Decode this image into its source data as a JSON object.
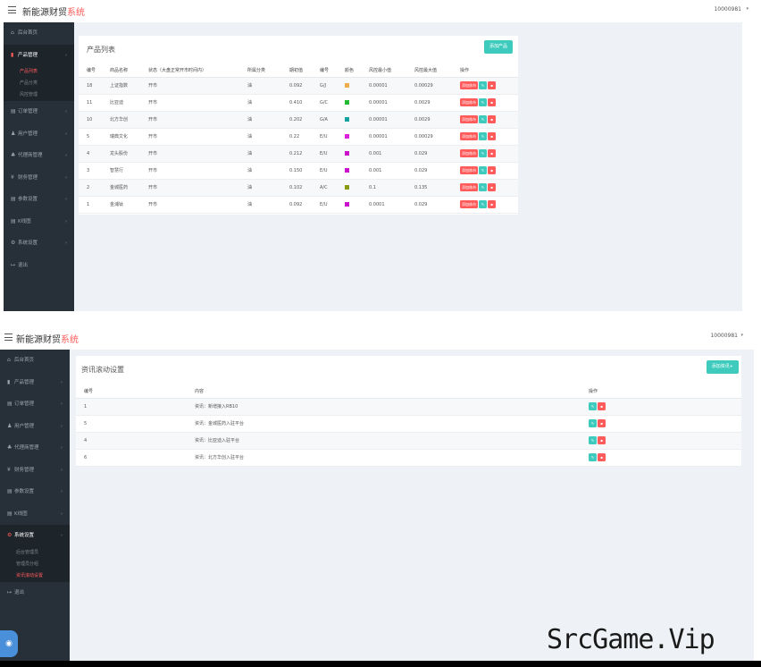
{
  "app": {
    "brand_main": "新能源财贸",
    "brand_accent": "系统",
    "user": "10000981"
  },
  "shot1": {
    "nav": [
      {
        "icon": "home-icon",
        "glyph": "⌂",
        "label": "后台首页"
      },
      {
        "icon": "product-icon",
        "glyph": "▮",
        "label": "产品管理",
        "active": true,
        "sub": [
          {
            "label": "产品列表",
            "current": true
          },
          {
            "label": "产品分类"
          },
          {
            "label": "风控管理"
          }
        ]
      },
      {
        "icon": "order-icon",
        "glyph": "▤",
        "label": "订单管理"
      },
      {
        "icon": "user-icon",
        "glyph": "♟",
        "label": "用户管理"
      },
      {
        "icon": "agent-icon",
        "glyph": "♣",
        "label": "代理商管理"
      },
      {
        "icon": "finance-icon",
        "glyph": "¥",
        "label": "财务管理"
      },
      {
        "icon": "params-icon",
        "glyph": "▤",
        "label": "参数设置"
      },
      {
        "icon": "log-icon",
        "glyph": "▤",
        "label": "K线图"
      },
      {
        "icon": "settings-icon",
        "glyph": "⚙",
        "label": "系统设置"
      },
      {
        "icon": "logout-icon",
        "glyph": "↦",
        "label": "退出"
      }
    ],
    "card_title": "产品列表",
    "add_button": "添加产品",
    "columns": [
      "编号",
      "商品名称",
      "状态（大盘正常开市时间内）",
      "所属分类",
      "期初值",
      "编号",
      "颜色",
      "风控最小值",
      "风控最大值",
      "操作"
    ],
    "rows": [
      {
        "id": "18",
        "name": "上证指数",
        "status": "开市",
        "cat": "油",
        "init": "0.092",
        "code": "G/J",
        "color": "#f0ad4e",
        "min": "0.00001",
        "max": "0.00029"
      },
      {
        "id": "11",
        "name": "比亚迪",
        "status": "开市",
        "cat": "油",
        "init": "0.410",
        "code": "G/C",
        "color": "#22bb33",
        "min": "0.00001",
        "max": "0.0029"
      },
      {
        "id": "10",
        "name": "北方华创",
        "status": "开市",
        "cat": "油",
        "init": "0.202",
        "code": "G/A",
        "color": "#17a2a2",
        "min": "0.00001",
        "max": "0.0029"
      },
      {
        "id": "5",
        "name": "瑞典文化",
        "status": "开市",
        "cat": "油",
        "init": "0.22",
        "code": "E/U",
        "color": "#dd22dd",
        "min": "0.00001",
        "max": "0.00029"
      },
      {
        "id": "4",
        "name": "龙头股份",
        "status": "开市",
        "cat": "油",
        "init": "0.212",
        "code": "E/U",
        "color": "#cc11cc",
        "min": "0.001",
        "max": "0.029"
      },
      {
        "id": "3",
        "name": "智慧行",
        "status": "开市",
        "cat": "油",
        "init": "0.150",
        "code": "E/U",
        "color": "#cc11cc",
        "min": "0.001",
        "max": "0.029"
      },
      {
        "id": "2",
        "name": "金城医药",
        "status": "开市",
        "cat": "油",
        "init": "0.102",
        "code": "A/C",
        "color": "#8a9a10",
        "min": "0.1",
        "max": "0.135"
      },
      {
        "id": "1",
        "name": "金浦钛",
        "status": "开市",
        "cat": "油",
        "init": "0.092",
        "code": "E/U",
        "color": "#cc11cc",
        "min": "0.0001",
        "max": "0.029"
      }
    ],
    "row_action_label": "添加休市"
  },
  "shot2": {
    "nav": [
      {
        "icon": "home-icon",
        "glyph": "⌂",
        "label": "后台首页"
      },
      {
        "icon": "product-icon",
        "glyph": "▮",
        "label": "产品管理"
      },
      {
        "icon": "order-icon",
        "glyph": "▤",
        "label": "订单管理"
      },
      {
        "icon": "user-icon",
        "glyph": "♟",
        "label": "用户管理"
      },
      {
        "icon": "agent-icon",
        "glyph": "♣",
        "label": "代理商管理"
      },
      {
        "icon": "finance-icon",
        "glyph": "¥",
        "label": "财务管理"
      },
      {
        "icon": "params-icon",
        "glyph": "▤",
        "label": "参数设置"
      },
      {
        "icon": "log-icon",
        "glyph": "▤",
        "label": "K线图"
      },
      {
        "icon": "settings-icon",
        "glyph": "⚙",
        "label": "系统设置",
        "active": true,
        "sub": [
          {
            "label": "后台管理员"
          },
          {
            "label": "管理员分组"
          },
          {
            "label": "资讯滚动设置",
            "current": true
          }
        ]
      },
      {
        "icon": "logout-icon",
        "glyph": "↦",
        "label": "退出"
      }
    ],
    "card_title": "资讯滚动设置",
    "add_button": "添加资讯+",
    "columns": [
      "编号",
      "内容",
      "操作"
    ],
    "rows": [
      {
        "id": "1",
        "content": "资讯：新增接入RB10"
      },
      {
        "id": "5",
        "content": "资讯：金城医药入驻平台"
      },
      {
        "id": "4",
        "content": "资讯：比亚迪入驻平台"
      },
      {
        "id": "6",
        "content": "资讯：北方华创入驻平台"
      }
    ]
  },
  "watermark": "SrcGame.Vip"
}
